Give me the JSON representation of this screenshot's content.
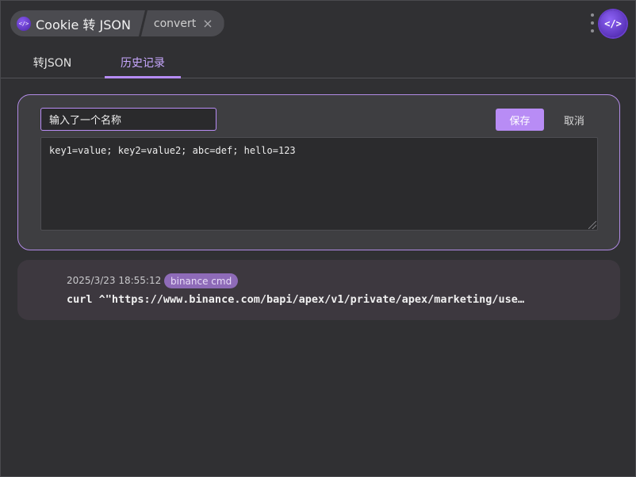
{
  "header": {
    "app_title": "Cookie 转 JSON",
    "tab_name": "convert",
    "close_symbol": "×",
    "logo_glyph": "</>",
    "avatar_glyph": "</>"
  },
  "tabs": [
    {
      "label": "转JSON",
      "active": false
    },
    {
      "label": "历史记录",
      "active": true
    }
  ],
  "editor": {
    "name_value": "输入了一个名称",
    "save_label": "保存",
    "cancel_label": "取消",
    "cookie_value": "key1=value; key2=value2; abc=def; hello=123"
  },
  "history": [
    {
      "timestamp": "2025/3/23 18:55:12",
      "tag": "binance cmd",
      "command": "curl ^\"https://www.binance.com/bapi/apex/v1/private/apex/marketing/use…"
    }
  ],
  "colors": {
    "accent": "#b88cf5",
    "background": "#303033",
    "card": "#3e3e41",
    "history_card": "#3d383f"
  }
}
